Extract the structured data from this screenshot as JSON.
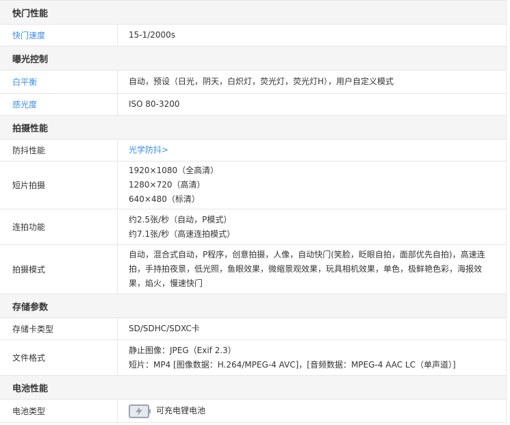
{
  "sections": [
    {
      "title": "快门性能",
      "rows": [
        {
          "label": "快门速度",
          "label_link": true,
          "lines": [
            "15-1/2000s"
          ]
        }
      ]
    },
    {
      "title": "曝光控制",
      "rows": [
        {
          "label": "白平衡",
          "label_link": true,
          "lines": [
            "自动，预设（日光，阴天，白炽灯，荧光灯，荧光灯H），用户自定义模式"
          ]
        },
        {
          "label": "感光度",
          "label_link": true,
          "lines": [
            "ISO 80-3200"
          ]
        }
      ]
    },
    {
      "title": "拍摄性能",
      "rows": [
        {
          "label": "防抖性能",
          "value_link": true,
          "lines": [
            "光学防抖>"
          ]
        },
        {
          "label": "短片拍摄",
          "lines": [
            "1920×1080（全高清）",
            "1280×720（高清）",
            "640×480（标清）"
          ]
        },
        {
          "label": "连拍功能",
          "lines": [
            "约2.5张/秒（自动，P模式）",
            "约7.1张/秒（高速连拍模式）"
          ]
        },
        {
          "label": "拍摄模式",
          "lines": [
            "自动，混合式自动，P程序，创意拍摄，人像，自动快门(笑脸，眨眼自拍，面部优先自拍)，高速连",
            "拍，手持拍夜景，低光照，鱼眼效果，微缩景观效果，玩具相机效果，单色，极鲜艳色彩，海报效",
            "果，焰火，慢速快门"
          ]
        }
      ]
    },
    {
      "title": "存储参数",
      "rows": [
        {
          "label": "存储卡类型",
          "lines": [
            "SD/SDHC/SDXC卡"
          ]
        },
        {
          "label": "文件格式",
          "lines": [
            "静止图像：JPEG（Exif 2.3）",
            "短片：MP4 [图像数据：H.264/MPEG-4 AVC]，[音频数据：MPEG-4 AAC LC（单声道）]"
          ]
        }
      ]
    },
    {
      "title": "电池性能",
      "rows": [
        {
          "label": "电池类型",
          "battery": true,
          "lines": [
            "可充电锂电池"
          ]
        }
      ]
    }
  ],
  "colors": {
    "link": "#3a8ee6",
    "header_bg": "#f5f5f5",
    "border": "#e6e6e6"
  },
  "icons": {
    "battery": "battery-charging-icon"
  }
}
